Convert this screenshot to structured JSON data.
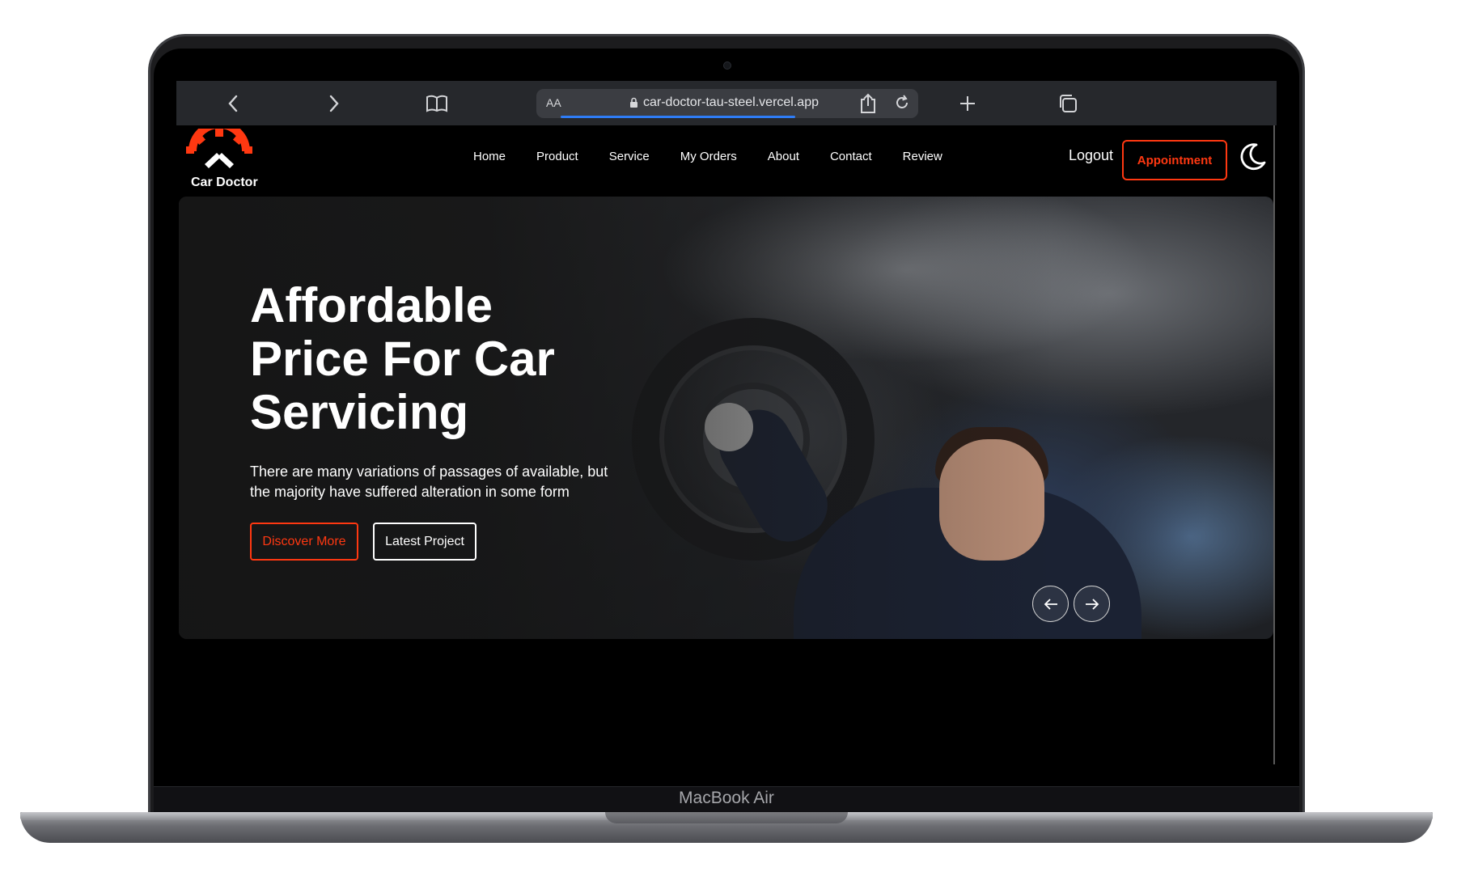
{
  "device": {
    "label": "MacBook Air"
  },
  "browser": {
    "url_aa": "AA",
    "url": "car-doctor-tau-steel.vercel.app",
    "icons": [
      "chevron-left-icon",
      "chevron-right-icon",
      "book-icon",
      "lock-icon",
      "reload-icon",
      "share-icon",
      "plus-icon",
      "tabs-icon"
    ]
  },
  "site": {
    "logo_text": "Car Doctor",
    "nav": [
      "Home",
      "Product",
      "Service",
      "My Orders",
      "About",
      "Contact",
      "Review"
    ],
    "logout": "Logout",
    "appointment": "Appointment",
    "theme_icon": "moon-icon",
    "accent": "#ff3811"
  },
  "hero": {
    "title_line1": "Affordable",
    "title_line2": "Price For Car",
    "title_line3": "Servicing",
    "subtitle_line1": "There are many variations of passages of available, but",
    "subtitle_line2": "the majority have suffered alteration in some form",
    "btn_discover": "Discover More",
    "btn_latest": "Latest Project"
  }
}
